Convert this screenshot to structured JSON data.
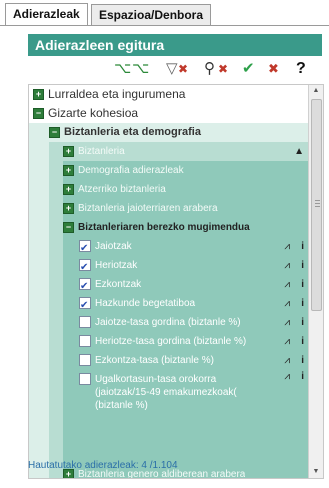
{
  "tabs": [
    {
      "label": "Adierazleak"
    },
    {
      "label": "Espazioa/Denbora"
    }
  ],
  "panel": {
    "title": "Adierazleen egitura",
    "toolbar_icons": [
      "expand-all-icon",
      "collapse-all-icon",
      "filter-icon",
      "clear-filter-icon",
      "search-icon",
      "clear-search-icon",
      "check-all-icon",
      "uncheck-all-icon",
      "help-icon"
    ],
    "toolbar_help": "?"
  },
  "tree": {
    "cat1": "Lurraldea eta ingurumena",
    "cat2": "Gizarte kohesioa",
    "sub1": "Biztanleria eta demografia",
    "items": [
      {
        "label": "Biztanleria",
        "expander": "+"
      },
      {
        "label": "Demografia adierazleak",
        "expander": "+"
      },
      {
        "label": "Atzerriko biztanleria",
        "expander": "+"
      },
      {
        "label": "Biztanleria jaioterriaren arabera",
        "expander": "+"
      }
    ],
    "open_item": {
      "label": "Biztanleriaren berezko mugimendua",
      "expander": "−"
    },
    "indicators": [
      {
        "label": "Jaiotzak",
        "checked": true
      },
      {
        "label": "Heriotzak",
        "checked": true
      },
      {
        "label": "Ezkontzak",
        "checked": true
      },
      {
        "label": "Hazkunde begetatiboa",
        "checked": true
      },
      {
        "label": "Jaiotze-tasa gordina (biztanle %)",
        "checked": false
      },
      {
        "label": "Heriotze-tasa gordina (biztanle %)",
        "checked": false
      },
      {
        "label": "Ezkontza-tasa (biztanle %)",
        "checked": false
      },
      {
        "label": "Ugalkortasun-tasa orokorra",
        "line2": "(jaiotzak/15-49 emakumezkoak(",
        "line3": "(biztanle %)",
        "checked": false
      }
    ],
    "partial_item": "Biztanleria genero aldiberean arabera"
  },
  "status": "Hautatutako adierazleak: 4 /1.104",
  "colors": {
    "accent": "#3a9a8a",
    "tree_bg": "#8fc9ba",
    "tree_bg_light": "#b8ddd2",
    "status_text": "#2b6fa8"
  }
}
